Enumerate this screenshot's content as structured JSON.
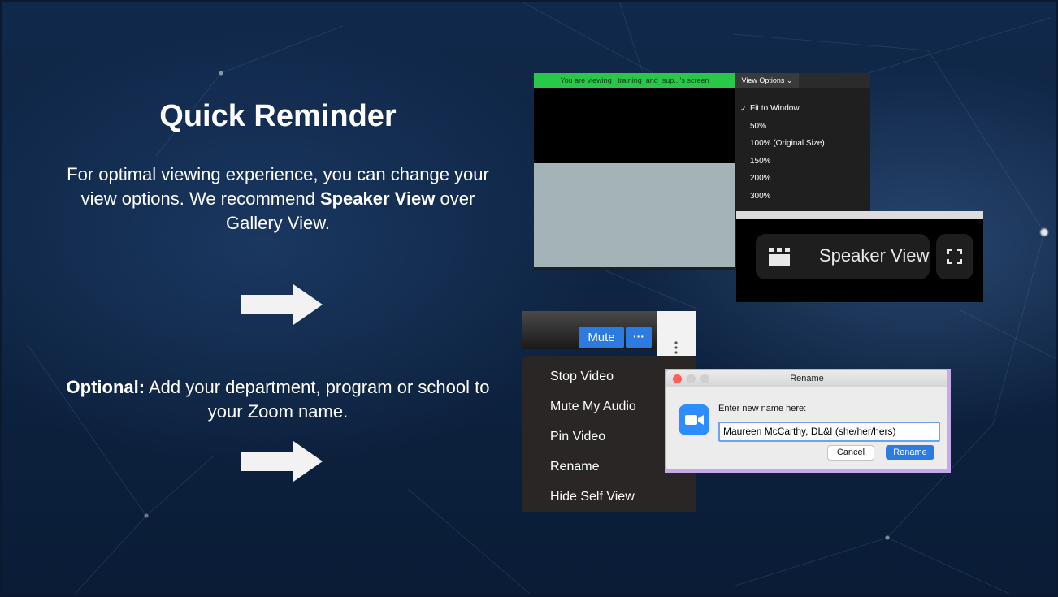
{
  "slide": {
    "title": "Quick Reminder",
    "paragraph1": {
      "intro": "For optimal viewing experience, you can change your view options. We recommend ",
      "bold": "Speaker View",
      "outro": " over Gallery View."
    },
    "paragraph2": {
      "bold": "Optional:",
      "text": " Add your department, program or school to your Zoom name."
    }
  },
  "view_options_screenshot": {
    "banner": "You are viewing _training_and_sup...'s screen",
    "button_label": "View Options",
    "menu_items": [
      "Fit to Window",
      "50%",
      "100% (Original Size)",
      "150%",
      "200%",
      "300%"
    ],
    "checked_item": "Fit to Window"
  },
  "speaker_view_screenshot": {
    "label": "Speaker View"
  },
  "participant_menu_screenshot": {
    "mute_label": "Mute",
    "more_label": "···",
    "menu_items": [
      "Stop Video",
      "Mute My Audio",
      "Pin Video",
      "Rename",
      "Hide Self View"
    ]
  },
  "rename_dialog": {
    "title": "Rename",
    "prompt": "Enter new name here:",
    "input_value": "Maureen McCarthy, DL&I (she/her/hers)",
    "cancel_label": "Cancel",
    "ok_label": "Rename"
  },
  "colors": {
    "background": "#0e2442",
    "zoom_blue": "#2d7ae0",
    "green_banner": "#2ac848"
  }
}
